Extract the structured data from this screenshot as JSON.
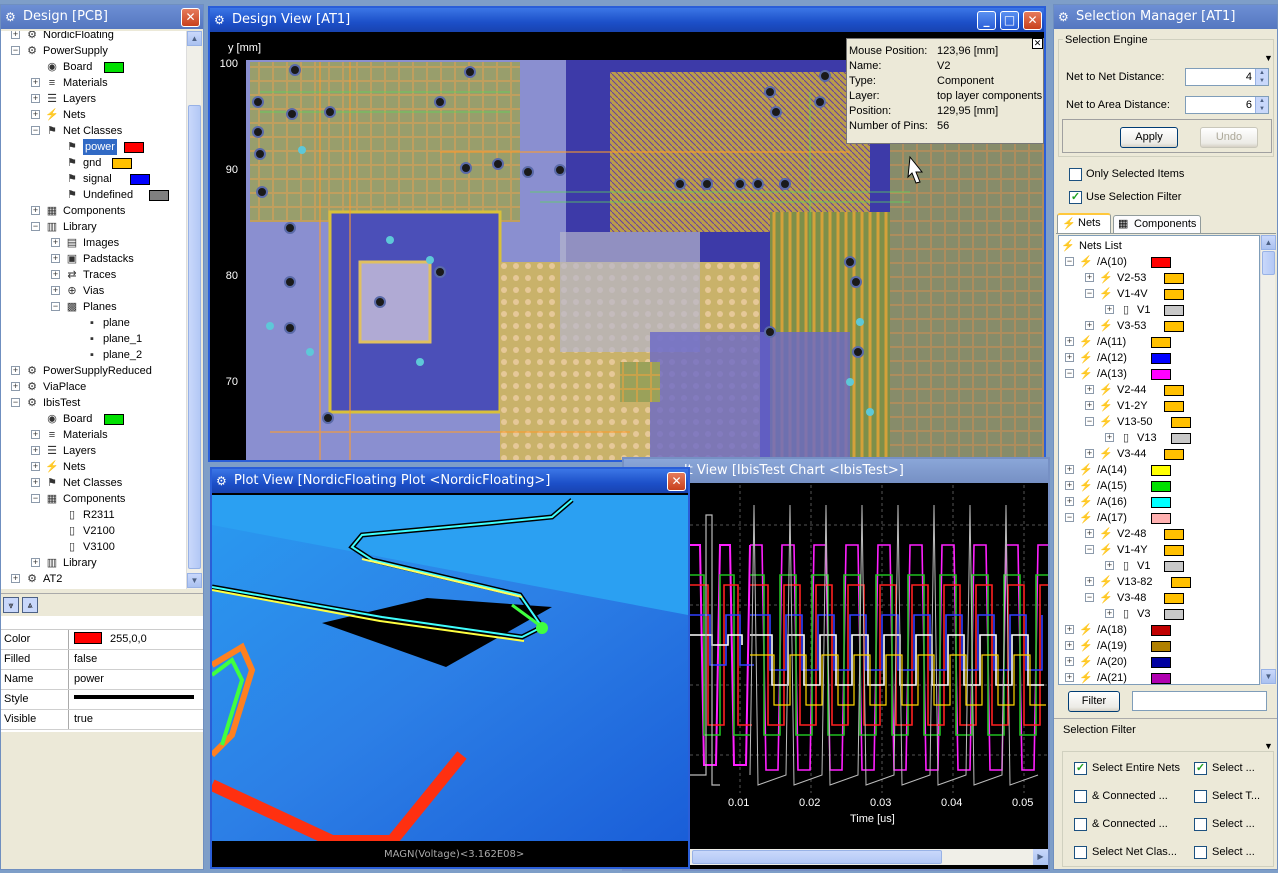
{
  "design_panel": {
    "title": "Design [PCB]",
    "tree": [
      {
        "label": "NordicFloating",
        "level": 0,
        "icon": "gear-icon",
        "exp": "+"
      },
      {
        "label": "PowerSupply",
        "level": 0,
        "icon": "gear-icon",
        "exp": "-"
      },
      {
        "label": "Board",
        "level": 1,
        "icon": "board-icon",
        "swatch": "#00e000"
      },
      {
        "label": "Materials",
        "level": 1,
        "icon": "materials-icon",
        "exp": "+"
      },
      {
        "label": "Layers",
        "level": 1,
        "icon": "layers-icon",
        "exp": "+"
      },
      {
        "label": "Nets",
        "level": 1,
        "icon": "nets-icon",
        "exp": "+"
      },
      {
        "label": "Net Classes",
        "level": 1,
        "icon": "netclass-icon",
        "exp": "-"
      },
      {
        "label": "power",
        "level": 2,
        "icon": "netclass-icon",
        "swatch": "#ff0000",
        "selected": true
      },
      {
        "label": "gnd",
        "level": 2,
        "icon": "netclass-icon",
        "swatch": "#ffc000"
      },
      {
        "label": "signal",
        "level": 2,
        "icon": "netclass-icon",
        "swatch": "#0000ff"
      },
      {
        "label": "Undefined",
        "level": 2,
        "icon": "netclass-icon",
        "swatch": "#808080"
      },
      {
        "label": "Components",
        "level": 1,
        "icon": "component-icon",
        "exp": "+"
      },
      {
        "label": "Library",
        "level": 1,
        "icon": "library-icon",
        "exp": "-"
      },
      {
        "label": "Images",
        "level": 2,
        "icon": "images-icon",
        "exp": "+"
      },
      {
        "label": "Padstacks",
        "level": 2,
        "icon": "padstack-icon",
        "exp": "+"
      },
      {
        "label": "Traces",
        "level": 2,
        "icon": "trace-icon",
        "exp": "+"
      },
      {
        "label": "Vias",
        "level": 2,
        "icon": "via-icon",
        "exp": "+"
      },
      {
        "label": "Planes",
        "level": 2,
        "icon": "planes-icon",
        "exp": "-"
      },
      {
        "label": "plane",
        "level": 3,
        "icon": "plane-icon"
      },
      {
        "label": "plane_1",
        "level": 3,
        "icon": "plane-icon"
      },
      {
        "label": "plane_2",
        "level": 3,
        "icon": "plane-icon"
      },
      {
        "label": "PowerSupplyReduced",
        "level": 0,
        "icon": "gear-icon",
        "exp": "+"
      },
      {
        "label": "ViaPlace",
        "level": 0,
        "icon": "gear-icon",
        "exp": "+"
      },
      {
        "label": "IbisTest",
        "level": 0,
        "icon": "gear-icon",
        "exp": "-"
      },
      {
        "label": "Board",
        "level": 1,
        "icon": "board-icon",
        "swatch": "#00e000"
      },
      {
        "label": "Materials",
        "level": 1,
        "icon": "materials-icon",
        "exp": "+"
      },
      {
        "label": "Layers",
        "level": 1,
        "icon": "layers-icon",
        "exp": "+"
      },
      {
        "label": "Nets",
        "level": 1,
        "icon": "nets-icon",
        "exp": "+"
      },
      {
        "label": "Net Classes",
        "level": 1,
        "icon": "netclass-icon",
        "exp": "+"
      },
      {
        "label": "Components",
        "level": 1,
        "icon": "component-icon",
        "exp": "-"
      },
      {
        "label": "R2311",
        "level": 2,
        "icon": "chip-icon"
      },
      {
        "label": "V2100",
        "level": 2,
        "icon": "chip-icon"
      },
      {
        "label": "V3100",
        "level": 2,
        "icon": "chip-icon"
      },
      {
        "label": "Library",
        "level": 1,
        "icon": "library-icon",
        "exp": "+"
      },
      {
        "label": "AT2",
        "level": 0,
        "icon": "gear-icon",
        "exp": "+"
      }
    ],
    "properties": [
      {
        "key": "Color",
        "value": "255,0,0",
        "swatch": "#ff0000"
      },
      {
        "key": "Filled",
        "value": "false"
      },
      {
        "key": "Name",
        "value": "power"
      },
      {
        "key": "Style",
        "value": "",
        "line": true
      },
      {
        "key": "Visible",
        "value": "true"
      }
    ]
  },
  "design_view": {
    "title": "Design View [AT1]",
    "y_axis_label": "y [mm]",
    "y_ticks": [
      "100",
      "90",
      "80",
      "70"
    ],
    "info": [
      {
        "key": "Mouse Position:",
        "value": "123,96 [mm]"
      },
      {
        "key": "Name:",
        "value": "V2"
      },
      {
        "key": "Type:",
        "value": "Component"
      },
      {
        "key": "Layer:",
        "value": "top layer components"
      },
      {
        "key": "Position:",
        "value": "129,95 [mm]"
      },
      {
        "key": "Number of Pins:",
        "value": "56"
      }
    ]
  },
  "plot_view": {
    "title": "Plot View [NordicFloating Plot <NordicFloating>]",
    "footer": "MAGN(Voltage)<3.162E08>"
  },
  "chart_view": {
    "title": "lt View [IbisTest Chart <IbisTest>]",
    "x_ticks": [
      "0.01",
      "0.02",
      "0.03",
      "0.04",
      "0.05"
    ],
    "x_label": "Time [us]"
  },
  "selection_manager": {
    "title": "Selection Manager [AT1]",
    "engine_label": "Selection Engine",
    "net_distance_label": "Net to Net Distance:",
    "net_distance_value": "4",
    "area_distance_label": "Net to Area Distance:",
    "area_distance_value": "6",
    "apply_label": "Apply",
    "undo_label": "Undo",
    "only_selected_label": "Only Selected Items",
    "only_selected_checked": false,
    "use_filter_label": "Use Selection Filter",
    "use_filter_checked": true,
    "tabs": [
      "Nets",
      "Components"
    ],
    "nets_list_label": "Nets List",
    "nets": [
      {
        "label": "/A(10)",
        "level": 0,
        "exp": "-",
        "swatch": "#ff0000"
      },
      {
        "label": "V2-53",
        "level": 1,
        "exp": "+",
        "swatch": "#ffc000"
      },
      {
        "label": "V1-4V",
        "level": 1,
        "exp": "-",
        "swatch": "#ffc000"
      },
      {
        "label": "V1",
        "level": 2,
        "exp": "+",
        "swatch": "#c8c8c8"
      },
      {
        "label": "V3-53",
        "level": 1,
        "exp": "+",
        "swatch": "#ffc000"
      },
      {
        "label": "/A(11)",
        "level": 0,
        "exp": "+",
        "swatch": "#ffc000"
      },
      {
        "label": "/A(12)",
        "level": 0,
        "exp": "+",
        "swatch": "#0000ff"
      },
      {
        "label": "/A(13)",
        "level": 0,
        "exp": "-",
        "swatch": "#ff00ff"
      },
      {
        "label": "V2-44",
        "level": 1,
        "exp": "+",
        "swatch": "#ffc000"
      },
      {
        "label": "V1-2Y",
        "level": 1,
        "exp": "+",
        "swatch": "#ffc000"
      },
      {
        "label": "V13-50",
        "level": 1,
        "exp": "-",
        "swatch": "#ffc000"
      },
      {
        "label": "V13",
        "level": 2,
        "exp": "+",
        "swatch": "#c8c8c8"
      },
      {
        "label": "V3-44",
        "level": 1,
        "exp": "+",
        "swatch": "#ffc000"
      },
      {
        "label": "/A(14)",
        "level": 0,
        "exp": "+",
        "swatch": "#ffff00"
      },
      {
        "label": "/A(15)",
        "level": 0,
        "exp": "+",
        "swatch": "#00e000"
      },
      {
        "label": "/A(16)",
        "level": 0,
        "exp": "+",
        "swatch": "#00ffff"
      },
      {
        "label": "/A(17)",
        "level": 0,
        "exp": "-",
        "swatch": "#ffb0b0"
      },
      {
        "label": "V2-48",
        "level": 1,
        "exp": "+",
        "swatch": "#ffc000"
      },
      {
        "label": "V1-4Y",
        "level": 1,
        "exp": "-",
        "swatch": "#ffc000"
      },
      {
        "label": "V1",
        "level": 2,
        "exp": "+",
        "swatch": "#c8c8c8"
      },
      {
        "label": "V13-82",
        "level": 1,
        "exp": "+",
        "swatch": "#ffc000"
      },
      {
        "label": "V3-48",
        "level": 1,
        "exp": "-",
        "swatch": "#ffc000"
      },
      {
        "label": "V3",
        "level": 2,
        "exp": "+",
        "swatch": "#c8c8c8"
      },
      {
        "label": "/A(18)",
        "level": 0,
        "exp": "+",
        "swatch": "#c00000"
      },
      {
        "label": "/A(19)",
        "level": 0,
        "exp": "+",
        "swatch": "#b08000"
      },
      {
        "label": "/A(20)",
        "level": 0,
        "exp": "+",
        "swatch": "#0000a0"
      },
      {
        "label": "/A(21)",
        "level": 0,
        "exp": "+",
        "swatch": "#b000b0"
      }
    ],
    "filter_button_label": "Filter",
    "filter_value": "",
    "selection_filter_label": "Selection Filter",
    "filter_checks": [
      {
        "label": "Select Entire Nets",
        "checked": true
      },
      {
        "label": "Select ...",
        "checked": true
      },
      {
        "label": "& Connected ...",
        "checked": false
      },
      {
        "label": "Select T...",
        "checked": false
      },
      {
        "label": "& Connected ...",
        "checked": false
      },
      {
        "label": "Select ...",
        "checked": false
      },
      {
        "label": "Select Net Clas...",
        "checked": false
      },
      {
        "label": "Select ...",
        "checked": false
      }
    ]
  }
}
